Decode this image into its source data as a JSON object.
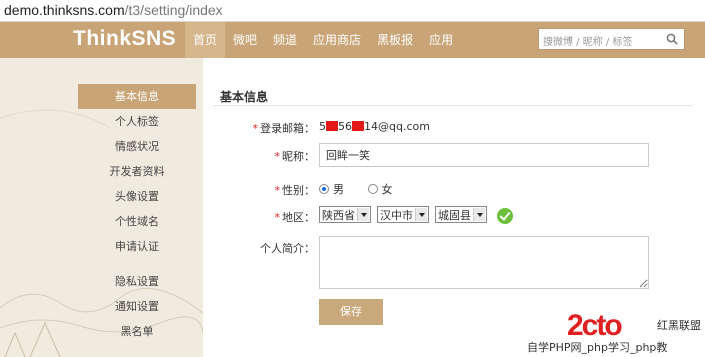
{
  "browser": {
    "url_host": "demo.thinksns.com",
    "url_path": "/t3/setting/index"
  },
  "nav": {
    "logo": "ThinkSNS",
    "items": [
      "首页",
      "微吧",
      "频道",
      "应用商店",
      "黑板报",
      "应用"
    ],
    "active_index": 0,
    "search_placeholder": "搜微博 / 昵称 / 标签"
  },
  "side_menu": {
    "group1": [
      "基本信息",
      "个人标签",
      "情感状况",
      "开发者资料",
      "头像设置",
      "个性域名",
      "申请认证"
    ],
    "group2": [
      "隐私设置",
      "通知设置",
      "黑名单"
    ],
    "active": "基本信息"
  },
  "form": {
    "title": "基本信息",
    "email_label": "登录邮箱：",
    "email_parts": [
      "5",
      "56",
      "14@qq.com"
    ],
    "nickname_label": "昵称：",
    "nickname_value": "回眸一笑",
    "gender_label": "性别：",
    "gender_options": [
      "男",
      "女"
    ],
    "gender_selected": "男",
    "region_label": "地区：",
    "region_selects": [
      "陕西省",
      "汉中市",
      "城固县"
    ],
    "intro_label": "个人简介：",
    "save_label": "保存"
  },
  "watermark": {
    "logo": "2cto",
    "brand": "红黑联盟",
    "bottom": "自学PHP网_php学习_php教"
  },
  "colors": {
    "accent": "#c8a476",
    "required": "#d22222",
    "valid": "#6bbf3a"
  }
}
